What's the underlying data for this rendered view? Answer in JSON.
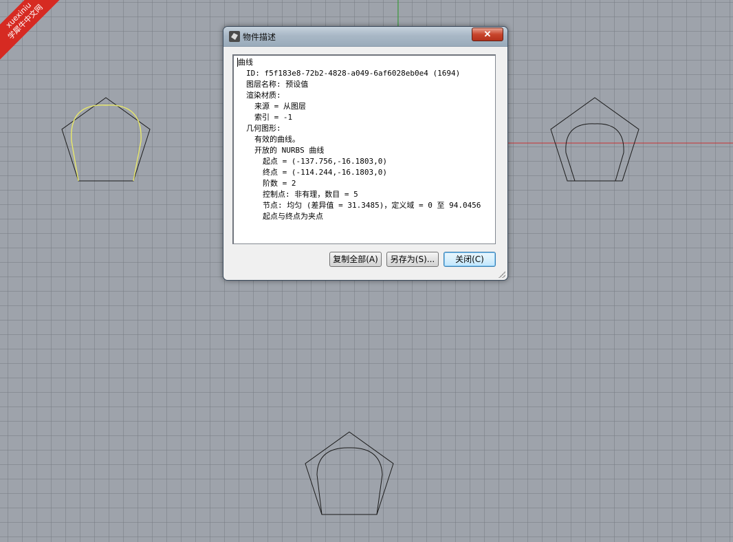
{
  "watermark": {
    "line1": "xuexiniu",
    "line2": "学犀牛中文网"
  },
  "colors": {
    "viewport_bg": "#9ea3ab",
    "grid": "#787c84",
    "axis_x": "#c83232",
    "axis_y": "#2ea02e",
    "selected_curve": "#e8e86a",
    "curve": "#1a1a1a"
  },
  "dialog": {
    "title": "物件描述",
    "close_glyph": "✕",
    "lines": [
      "曲线",
      "ID: f5f183e8-72b2-4828-a049-6af6028eb0e4 (1694)",
      "图层名称: 预设值",
      "渲染材质:",
      "来源 = 从图层",
      "索引 = -1",
      "几何图形:",
      "有效的曲线。",
      "开放的 NURBS 曲线",
      "起点 = (-137.756,-16.1803,0)",
      "终点 = (-114.244,-16.1803,0)",
      "阶数 = 2",
      "控制点: 非有理，数目 = 5",
      "节点: 均匀 (差异值 = 31.3485)，定义域 = 0 至 94.0456",
      "起点与终点为夹点"
    ],
    "buttons": {
      "copy_all": "复制全部(A)",
      "save_as": "另存为(S)...",
      "close": "关闭(C)"
    }
  }
}
